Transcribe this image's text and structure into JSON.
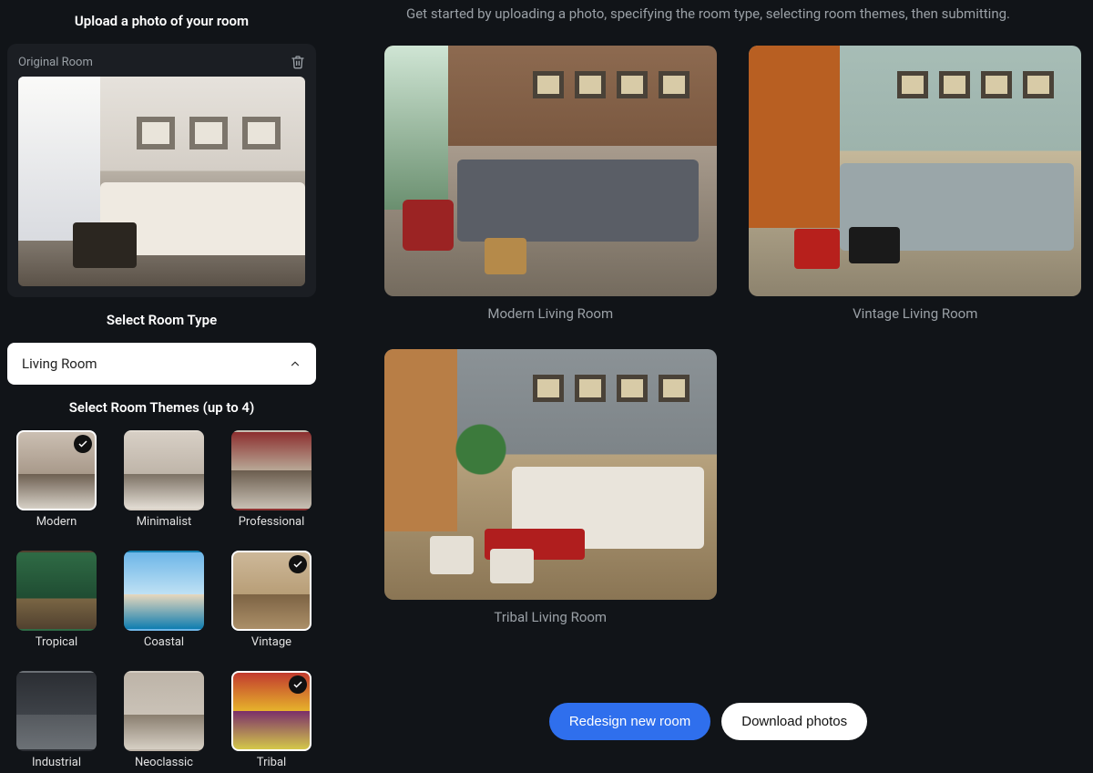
{
  "sidebar": {
    "upload_title": "Upload a photo of your room",
    "original_label": "Original Room",
    "room_type_title": "Select Room Type",
    "room_type_value": "Living Room",
    "themes_title": "Select Room Themes (up to 4)",
    "themes": [
      {
        "label": "Modern",
        "selected": true,
        "thumbClass": "t-modern"
      },
      {
        "label": "Minimalist",
        "selected": false,
        "thumbClass": "t-minimal"
      },
      {
        "label": "Professional",
        "selected": false,
        "thumbClass": "t-prof"
      },
      {
        "label": "Tropical",
        "selected": false,
        "thumbClass": "t-trop"
      },
      {
        "label": "Coastal",
        "selected": false,
        "thumbClass": "t-coast"
      },
      {
        "label": "Vintage",
        "selected": true,
        "thumbClass": "t-vint"
      },
      {
        "label": "Industrial",
        "selected": false,
        "thumbClass": "t-indus"
      },
      {
        "label": "Neoclassic",
        "selected": false,
        "thumbClass": "t-neo"
      },
      {
        "label": "Tribal",
        "selected": true,
        "thumbClass": "t-tribal"
      }
    ]
  },
  "main": {
    "instruction": "Get started by uploading a photo, specifying the room type, selecting room themes, then submitting.",
    "results": [
      {
        "caption": "Modern Living Room",
        "imgClass": "r-modern"
      },
      {
        "caption": "Vintage Living Room",
        "imgClass": "r-vintage"
      },
      {
        "caption": "Tribal Living Room",
        "imgClass": "r-tribal"
      }
    ],
    "redesign_label": "Redesign new room",
    "download_label": "Download photos"
  }
}
